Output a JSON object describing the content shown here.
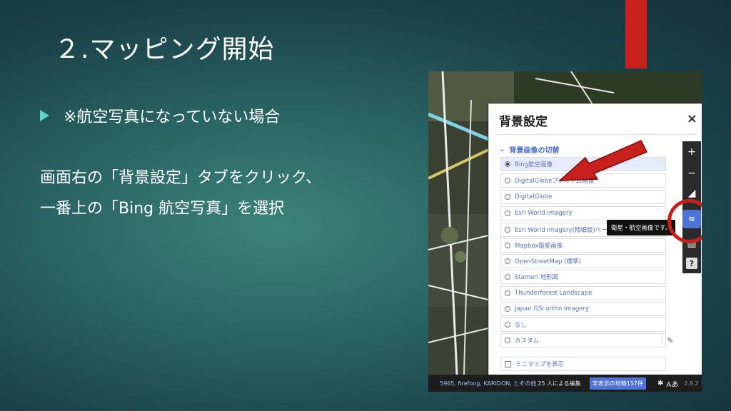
{
  "slide": {
    "title": "２.マッピング開始",
    "bullet": "※航空写真になっていない場合",
    "body_line1": "画面右の「背景設定」タブをクリック、",
    "body_line2": "一番上の「Bing 航空写真」を選択"
  },
  "panel": {
    "title": "背景設定",
    "close": "×",
    "section_title": "背景画像の切替",
    "options": [
      {
        "label": "Bing航空画像",
        "selected": true
      },
      {
        "label": "DigitalGlobeプレミアム画像",
        "selected": false
      },
      {
        "label": "DigitalGlobe",
        "selected": false
      },
      {
        "label": "Esri World Imagery",
        "selected": false
      },
      {
        "label": "Esri World Imagery(精細版)ベータ",
        "selected": false
      },
      {
        "label": "Mapbox衛星画像",
        "selected": false
      },
      {
        "label": "OpenStreetMap (標準)",
        "selected": false
      },
      {
        "label": "Stamen 地形図",
        "selected": false
      },
      {
        "label": "Thunderforest Landscape",
        "selected": false
      },
      {
        "label": "Japan GSI ortho Imagery",
        "selected": false
      },
      {
        "label": "なし",
        "selected": false
      },
      {
        "label": "カスタム",
        "selected": false
      }
    ],
    "tooltip": "衛星・航空画像です。",
    "minimap": "ミニマップを表示"
  },
  "controls": {
    "zoom_in": "+",
    "zoom_out": "−",
    "help": "?"
  },
  "footer": {
    "credit": "5965, firefong, KARIDON, とその他",
    "edit": "25 人による編集",
    "hidden_features": "非表示の地物157件",
    "version": "2.8.2"
  },
  "colors": {
    "accent_red": "#c8201c",
    "bullet_cyan": "#5fd3c8",
    "selection_blue": "#4f74d8"
  }
}
